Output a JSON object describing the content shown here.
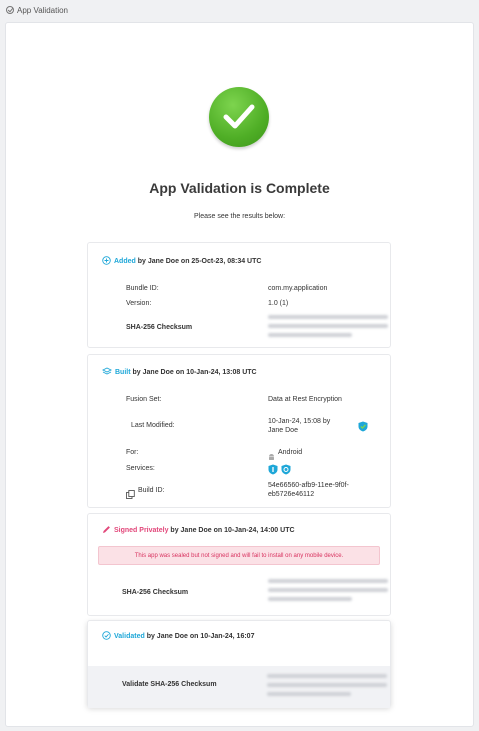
{
  "window": {
    "title": "App Validation"
  },
  "header": {
    "heading": "App Validation is Complete",
    "subheading": "Please see the results below:"
  },
  "added": {
    "status": "Added",
    "meta": "by Jane Doe on 25-Oct-23, 08:34 UTC",
    "bundle_label": "Bundle ID:",
    "bundle_value": "com.my.application",
    "version_label": "Version:",
    "version_value": "1.0 (1)",
    "checksum_label": "SHA-256 Checksum"
  },
  "built": {
    "status": "Built",
    "meta": "by Jane Doe on 10-Jan-24, 13:08 UTC",
    "fusion_label": "Fusion Set:",
    "fusion_value": "Data at Rest Encryption",
    "modified_label": "Last Modified:",
    "modified_value": "10-Jan-24, 15:08 by Jane Doe",
    "for_label": "For:",
    "for_value": "Android",
    "services_label": "Services:",
    "build_id_label": "Build ID:",
    "build_id_value": "54e66560-afb9-11ee-9f0f-eb5726e46112"
  },
  "signed": {
    "status": "Signed Privately",
    "meta": "by Jane Doe on 10-Jan-24, 14:00 UTC",
    "warning": "This app was sealed but not signed and will fail to install on any mobile device.",
    "checksum_label": "SHA-256 Checksum"
  },
  "validated": {
    "status": "Validated",
    "meta": "by Jane Doe on 10-Jan-24, 16:07",
    "checksum_label": "Validate SHA-256 Checksum"
  },
  "colors": {
    "accent": "#1ea7d8",
    "success": "#4fae26",
    "warning_text": "#d8325f",
    "warning_bg": "#fbe1e6"
  },
  "icons": {
    "added": "plus-circle-icon",
    "built": "layers-icon",
    "signed": "pen-icon",
    "validated": "check-circle-icon",
    "platform": "android-icon",
    "services": "shield-badge-icon",
    "build_id": "copy-icon"
  }
}
